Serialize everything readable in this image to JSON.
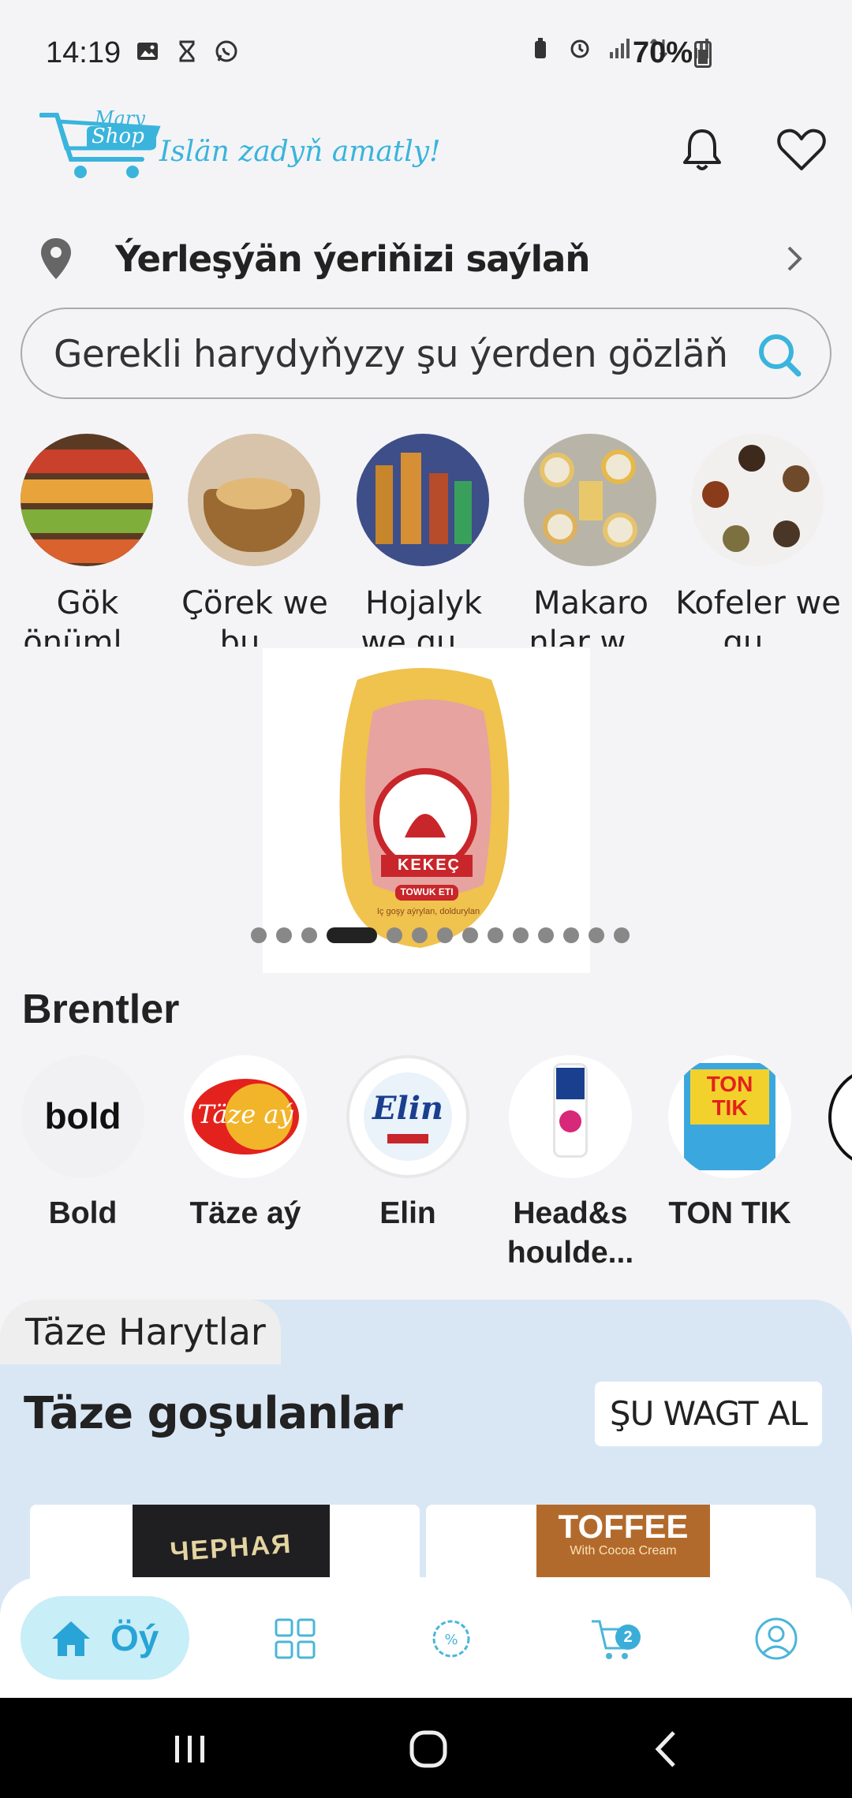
{
  "status_bar": {
    "time": "14:19",
    "battery": "70%",
    "left_icons": [
      "image-icon",
      "hourglass-icon",
      "whatsapp-icon"
    ],
    "right_icons": [
      "recycle-icon",
      "alarm-icon",
      "signal-icon",
      "data-icon",
      "signal-icon",
      "battery-charging-icon"
    ]
  },
  "header": {
    "logo_top": "Mary",
    "logo_bottom": "Shop",
    "slogan": "Islän zadyň amatly!",
    "icons": [
      "bell-icon",
      "heart-icon"
    ]
  },
  "location": {
    "label": "Ýerleşýän ýeriňizi saýlaň",
    "icons": [
      "location-pin-icon",
      "chevron-right-icon"
    ]
  },
  "search": {
    "placeholder": "Gerekli harydyňyzy şu ýerden gözläň",
    "icon": "search-icon"
  },
  "categories": [
    {
      "label": "Gök önüml..."
    },
    {
      "label": "Çörek we bu..."
    },
    {
      "label": "Hojalyk we gu..."
    },
    {
      "label": "Makaro nlar w..."
    },
    {
      "label": "Kofeler we gu..."
    }
  ],
  "banner": {
    "brand": "KEKEÇ",
    "subtitle": "TOWUK ETI",
    "small_text": "Iç goşy aýrylan, doldurylan",
    "slide_count": 14,
    "active_slide": 4
  },
  "brands": {
    "title": "Brentler",
    "items": [
      {
        "label": "Bold",
        "logo_text": "bold"
      },
      {
        "label": "Täze aý",
        "logo_text": "Täze aý"
      },
      {
        "label": "Elin",
        "logo_text": "Elin"
      },
      {
        "label": "Head&s houlde...",
        "logo_text": ""
      },
      {
        "label": "TON TIK",
        "logo_text": "TON TIK"
      }
    ]
  },
  "fresh": {
    "tab_label": "Täze Harytlar",
    "title": "Täze goşulanlar",
    "button": "ŞU WAGT AL",
    "product_texts": [
      "ЧЕРНАЯ",
      "TOFFEE",
      "With Cocoa Cream"
    ]
  },
  "bottom_nav": {
    "home_label": "Öý",
    "cart_count": "2",
    "icons": [
      "home-icon",
      "catalog-grid-icon",
      "discount-icon",
      "cart-icon",
      "profile-icon"
    ]
  },
  "colors": {
    "accent": "#29a4d6",
    "accent_bg": "#c8eef8",
    "fresh_bg": "#d9e7f5",
    "page_bg": "#f4f4f6"
  }
}
